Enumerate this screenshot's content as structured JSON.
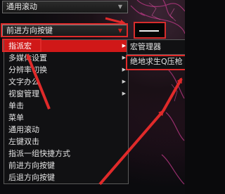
{
  "top_dropdown": {
    "value": "通用滚动"
  },
  "main_dropdown": {
    "value": "前进方向按键"
  },
  "menu": {
    "items": [
      {
        "label": "指派宏",
        "has_submenu": true,
        "active": true
      },
      {
        "label": "多媒体设置",
        "has_submenu": true
      },
      {
        "label": "分辨率切换",
        "has_submenu": true
      },
      {
        "label": "文字办公",
        "has_submenu": true
      },
      {
        "label": "视窗管理",
        "has_submenu": true
      },
      {
        "label": "单击"
      },
      {
        "label": "菜单"
      },
      {
        "label": "通用滚动"
      },
      {
        "label": "左键双击"
      },
      {
        "label": "指派一组快捷方式"
      },
      {
        "label": "前进方向按键"
      },
      {
        "label": "后退方向按键"
      }
    ]
  },
  "submenu": {
    "items": [
      {
        "label": "宏管理器"
      },
      {
        "label": "绝地求生Q压枪"
      }
    ]
  },
  "colors": {
    "accent": "#d01818",
    "annotation": "#e02a2a"
  }
}
